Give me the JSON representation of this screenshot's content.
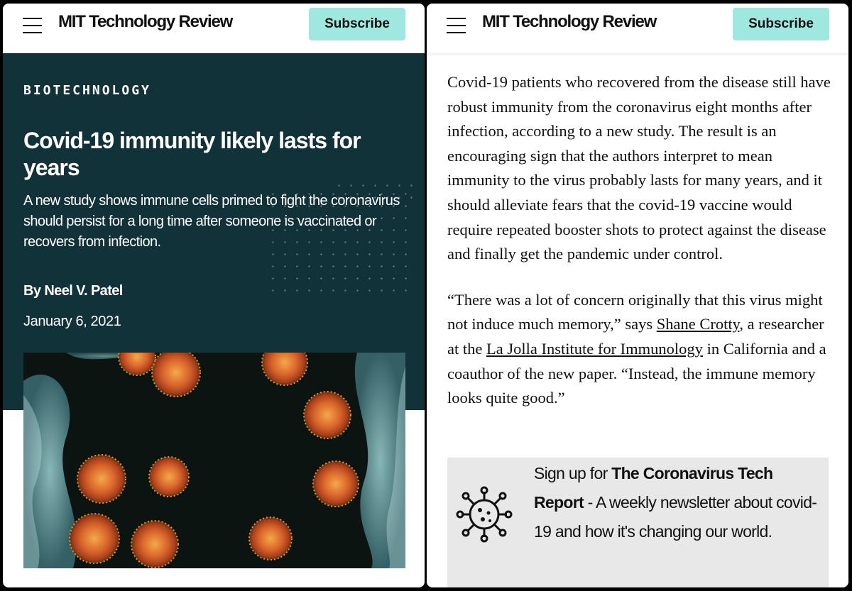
{
  "left_screen": {
    "header": {
      "logo": "MIT Technology Review",
      "subscribe_label": "Subscribe"
    },
    "article": {
      "category": "BIOTECHNOLOGY",
      "headline": "Covid-19 immunity likely lasts for years",
      "dek": "A new study shows immune cells primed to fight the coronavirus should persist for a long time after someone is vaccinated or recovers from infection.",
      "byline": "By Neel V. Patel",
      "date": "January 6, 2021"
    }
  },
  "right_screen": {
    "header": {
      "logo": "MIT Technology Review",
      "subscribe_label": "Subscribe"
    },
    "paragraphs": [
      {
        "text": "Covid-19 patients who recovered from the disease still have robust immunity from the coronavirus eight months after infection, according to a new study. The result is an encouraging sign that the authors interpret to mean immunity to the virus probably lasts for many years, and it should alleviate fears that the covid-19 vaccine would require repeated booster shots to protect against the disease and finally get the pandemic under control."
      },
      {
        "before_link1": "“There was a lot of concern originally that this virus might not induce much memory,” says ",
        "link1": "Shane Crotty",
        "between_links": ", a researcher at the ",
        "link2": "La Jolla Institute for Immunology",
        "after_link2": " in California and a coauthor of the new paper. “Instead, the immune memory looks quite good.”"
      }
    ],
    "newsletter": {
      "prefix": "Sign up for ",
      "name": "The Coronavirus Tech Report",
      "suffix": " - A weekly newsletter about covid-19 and how it's changing our world.",
      "icon": "virus-icon"
    }
  },
  "colors": {
    "hero_background": "#123239",
    "subscribe_button": "#9ee8e0",
    "signup_box": "#e8e8e8"
  }
}
